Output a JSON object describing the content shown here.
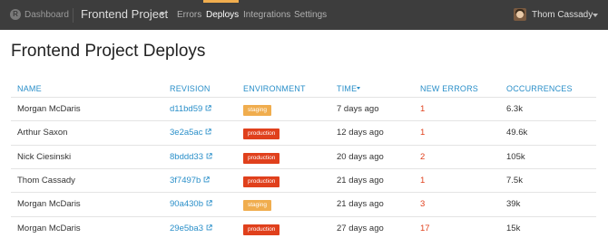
{
  "topbar": {
    "dashboard_label": "Dashboard",
    "project_name": "Frontend Project",
    "nav": [
      "Errors",
      "Deploys",
      "Integrations",
      "Settings"
    ],
    "active_nav": "Deploys",
    "user_name": "Thom Cassady"
  },
  "page": {
    "title": "Frontend Project Deploys"
  },
  "table": {
    "columns": {
      "name": "NAME",
      "revision": "REVISION",
      "environment": "ENVIRONMENT",
      "time": "TIME",
      "new_errors": "NEW ERRORS",
      "occurrences": "OCCURRENCES"
    },
    "sorted_by": "TIME",
    "rows": [
      {
        "name": "Morgan McDaris",
        "revision": "d11bd59",
        "environment": "staging",
        "time": "7 days ago",
        "new_errors": "1",
        "occurrences": "6.3k"
      },
      {
        "name": "Arthur Saxon",
        "revision": "3e2a5ac",
        "environment": "production",
        "time": "12 days ago",
        "new_errors": "1",
        "occurrences": "49.6k"
      },
      {
        "name": "Nick Ciesinski",
        "revision": "8bddd33",
        "environment": "production",
        "time": "20 days ago",
        "new_errors": "2",
        "occurrences": "105k"
      },
      {
        "name": "Thom Cassady",
        "revision": "3f7497b",
        "environment": "production",
        "time": "21 days ago",
        "new_errors": "1",
        "occurrences": "7.5k"
      },
      {
        "name": "Morgan McDaris",
        "revision": "90a430b",
        "environment": "staging",
        "time": "21 days ago",
        "new_errors": "3",
        "occurrences": "39k"
      },
      {
        "name": "Morgan McDaris",
        "revision": "29e5ba3",
        "environment": "production",
        "time": "27 days ago",
        "new_errors": "17",
        "occurrences": "15k"
      }
    ]
  },
  "colors": {
    "topbar_bg": "#3d3d3d",
    "active_accent": "#f0ad4e",
    "link": "#2a8fc9",
    "staging": "#f0ad4e",
    "production": "#e0401c",
    "error_count": "#e0401c"
  },
  "icons": {
    "dashboard": "dashboard-logo-icon",
    "project_dropdown": "chevron-down-icon",
    "user_dropdown": "chevron-down-icon",
    "revision_link": "external-link-icon",
    "sort": "sort-desc-icon"
  }
}
